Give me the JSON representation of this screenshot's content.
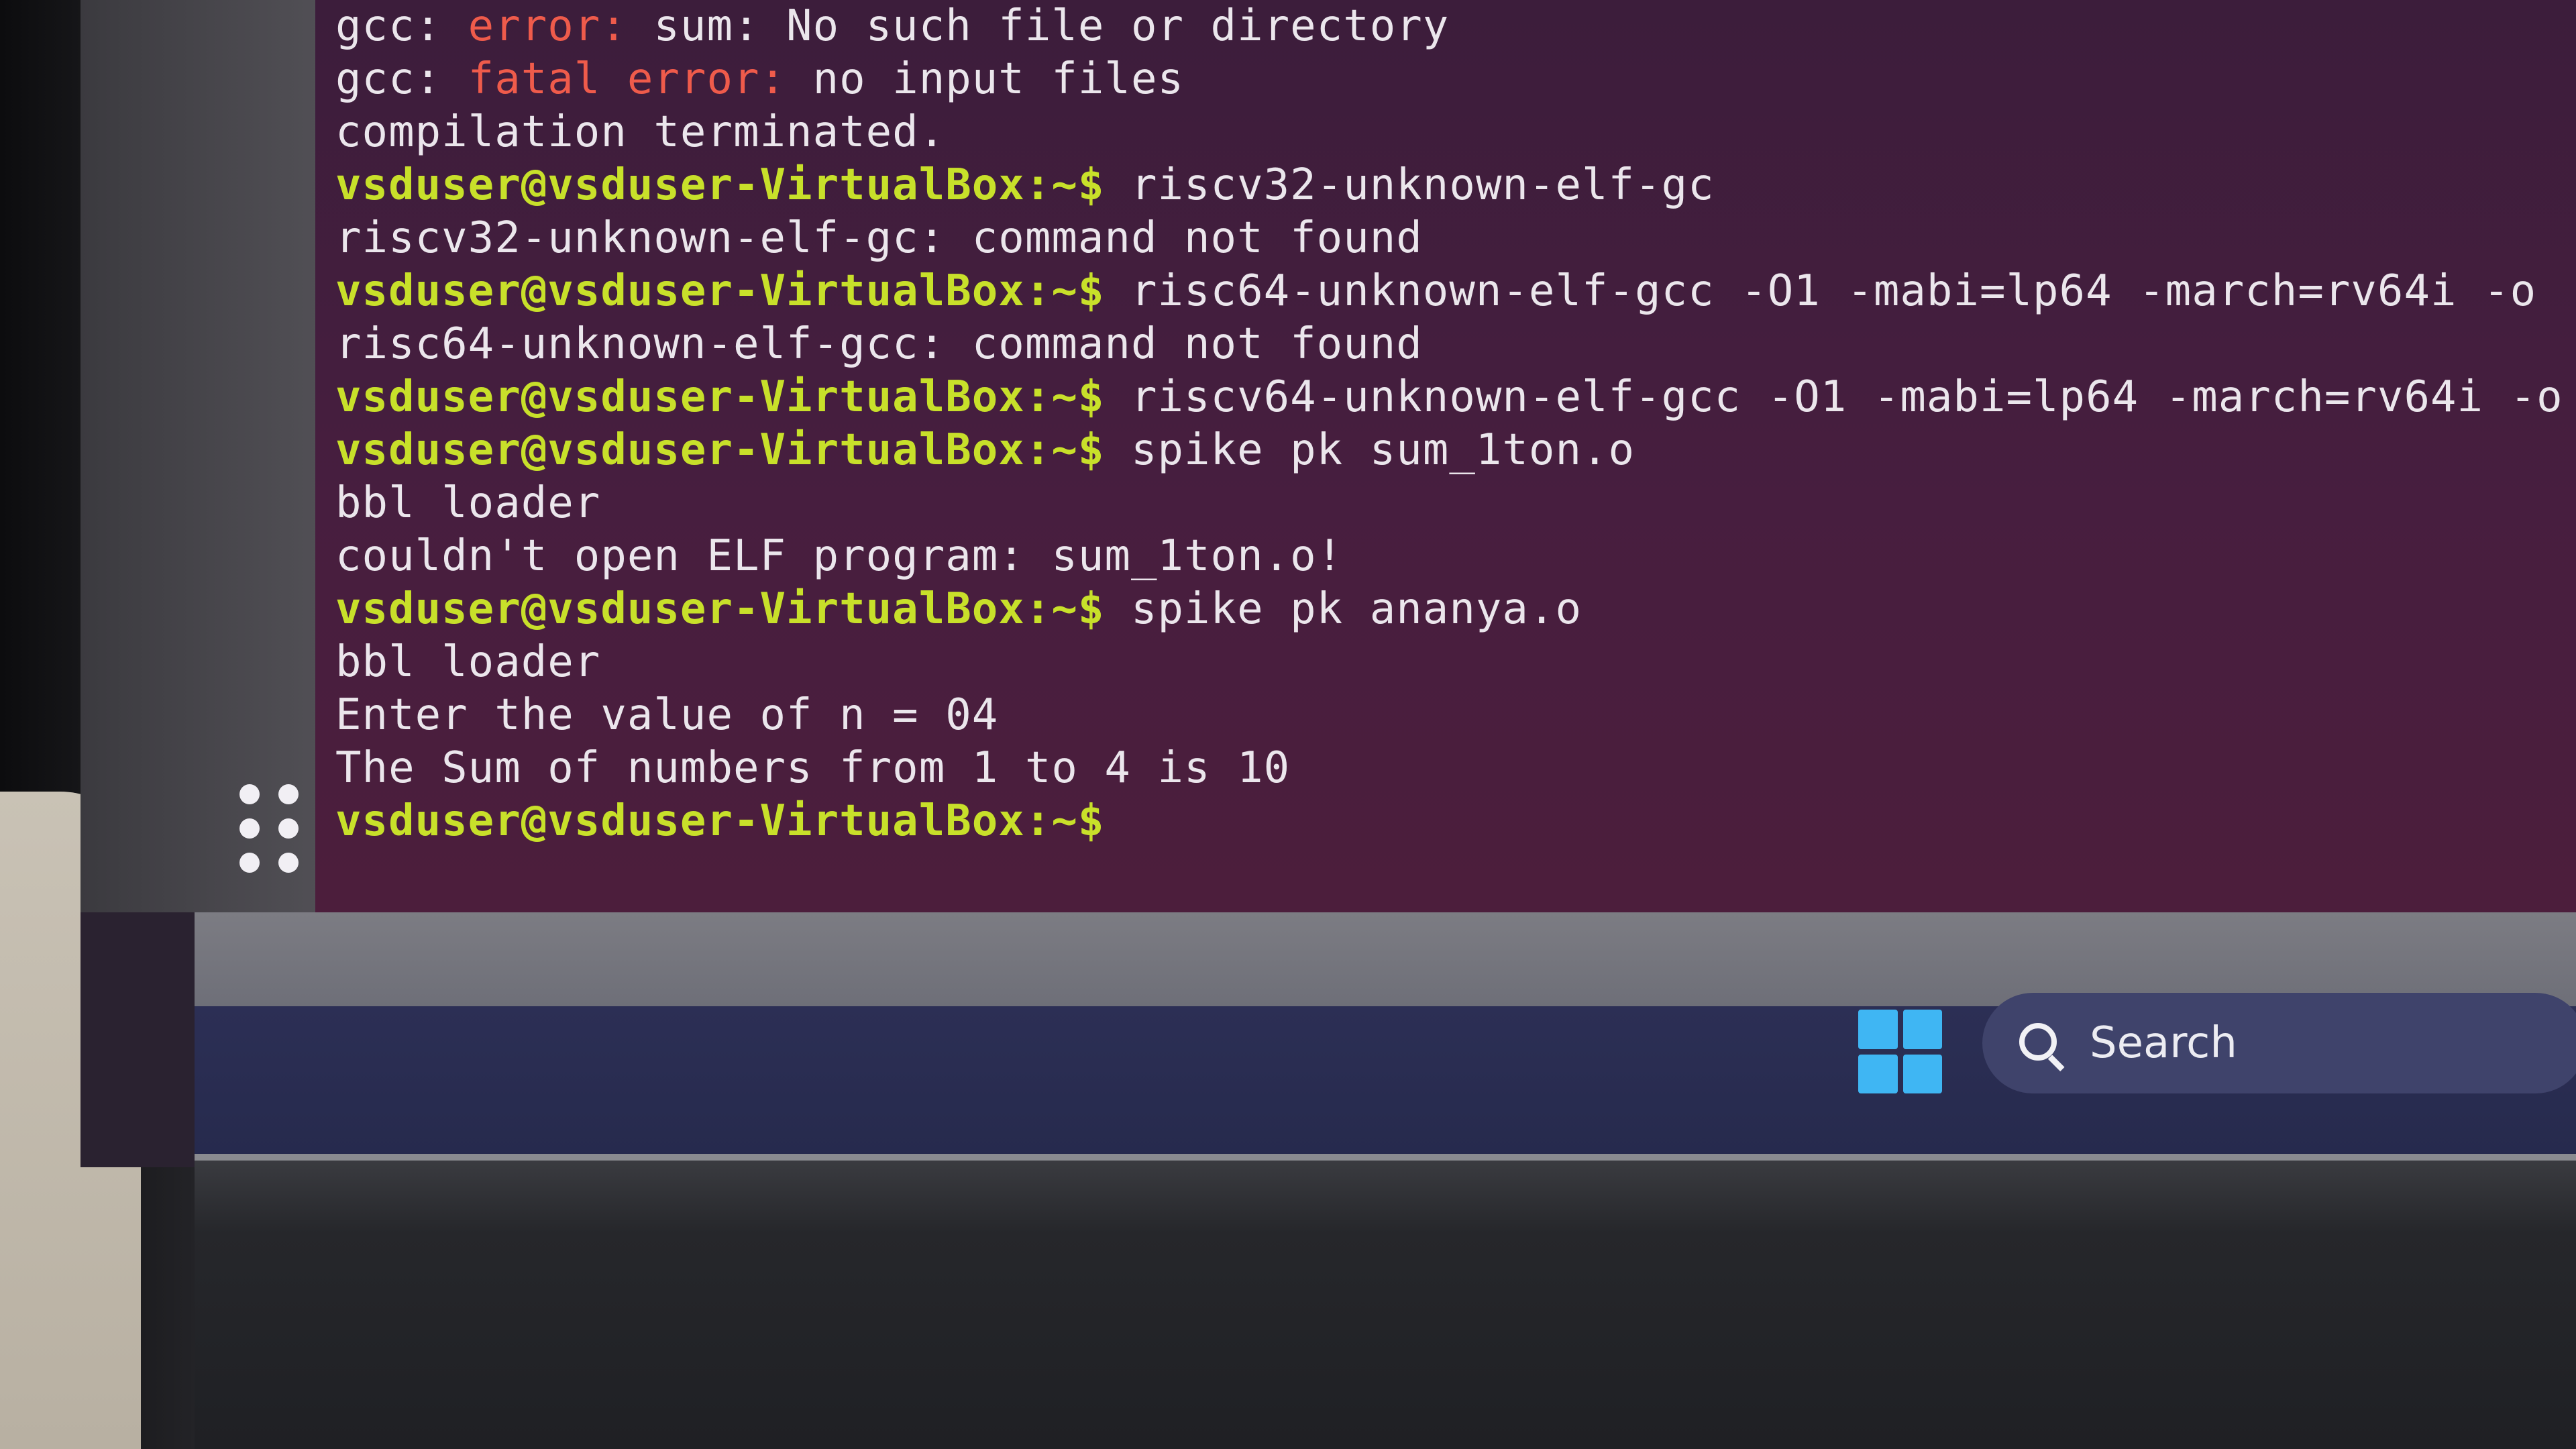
{
  "terminal": {
    "lines": [
      {
        "prefix": "gcc: ",
        "error_part": "error: ",
        "text": "sum: No such file or directory"
      },
      {
        "prefix": "gcc: ",
        "error_part": "fatal error: ",
        "text": "no input files"
      },
      {
        "text": "compilation terminated."
      },
      {
        "prompt": "vsduser@vsduser-VirtualBox:~$",
        "command": " riscv32-unknown-elf-gc"
      },
      {
        "text": "riscv32-unknown-elf-gc: command not found"
      },
      {
        "prompt": "vsduser@vsduser-VirtualBox:~$",
        "command": " risc64-unknown-elf-gcc -O1 -mabi=lp64 -march=rv64i -o"
      },
      {
        "text": "risc64-unknown-elf-gcc: command not found"
      },
      {
        "prompt": "vsduser@vsduser-VirtualBox:~$",
        "command": " riscv64-unknown-elf-gcc -O1 -mabi=lp64 -march=rv64i -o"
      },
      {
        "prompt": "vsduser@vsduser-VirtualBox:~$",
        "command": " spike pk sum_1ton.o"
      },
      {
        "text": "bbl loader"
      },
      {
        "text": "couldn't open ELF program: sum_1ton.o!"
      },
      {
        "prompt": "vsduser@vsduser-VirtualBox:~$",
        "command": " spike pk ananya.o"
      },
      {
        "text": "bbl loader"
      },
      {
        "text": "Enter the value of n = 04"
      },
      {
        "text": "The Sum of numbers from 1 to 4 is 10"
      },
      {
        "prompt": "vsduser@vsduser-VirtualBox:~$",
        "command": ""
      }
    ]
  },
  "taskbar": {
    "search_label": "Search"
  },
  "colors": {
    "prompt": "#c8e02a",
    "error": "#ef5b4b",
    "terminal_bg": "#471e3f",
    "text": "#ebe6ec"
  }
}
